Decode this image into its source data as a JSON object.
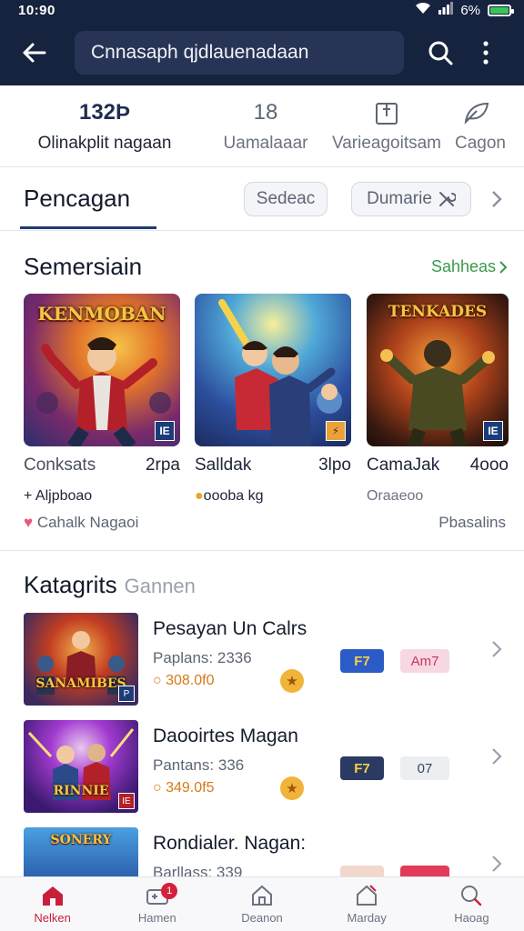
{
  "status": {
    "time": "10:90",
    "battery": "6%"
  },
  "header": {
    "search_text": "Cnnasaph qjdlauenadaan"
  },
  "stats": [
    {
      "value": "132Þ",
      "label": "Olinakplit nagaan"
    },
    {
      "value": "18",
      "label": "Uamalaaar"
    },
    {
      "value": "",
      "label": "Varieagoitsam"
    },
    {
      "value": "",
      "label": "Cagon"
    }
  ],
  "tabs": {
    "active": "Pencagan",
    "chip1": "Sedeac",
    "chip2": "Dumarie"
  },
  "featured": {
    "title": "Semersiain",
    "see_all": "Sahheas",
    "cards": [
      {
        "banner": "KENMOBAN",
        "badge": "IE",
        "name": "Conksats",
        "count": "2rpa",
        "meta": "+ Aljpboao",
        "extra": "Cahalk Nagaoi"
      },
      {
        "banner": "",
        "badge": "",
        "name": "Salldak",
        "count": "3lpo",
        "meta": "oooba kg",
        "extra": ""
      },
      {
        "banner": "TENKADES",
        "badge": "IE",
        "name": "CamaJak",
        "count": "4ooo",
        "meta": "Oraaeoo",
        "extra": "Pbasalins"
      }
    ]
  },
  "categories": {
    "title": "Katagrits",
    "subtitle": "Gannen",
    "items": [
      {
        "thumb_title": "SANAMIBES",
        "name": "Pesayan Un Calrs",
        "players": "Paplans: 2336",
        "price": "308.0f0",
        "tag_a": "F7",
        "tag_b": "Am7"
      },
      {
        "thumb_title": "RINNIE",
        "name": "Daooirtes Magan",
        "players": "Pantans: 336",
        "price": "349.0f5",
        "tag_a": "F7",
        "tag_b": "07"
      },
      {
        "thumb_title": "SONERY",
        "name": "Rondialer. Nagan:",
        "players": "Barllass: 339",
        "price": "",
        "tag_a": "",
        "tag_b": ""
      }
    ]
  },
  "nav": [
    {
      "label": "Nelken"
    },
    {
      "label": "Hamen",
      "badge": "1"
    },
    {
      "label": "Deanon"
    },
    {
      "label": "Marday"
    },
    {
      "label": "Haoag"
    }
  ],
  "colors": {
    "header_bg": "#16233f",
    "accent_green": "#3a9a4a",
    "nav_active": "#c8203a"
  }
}
